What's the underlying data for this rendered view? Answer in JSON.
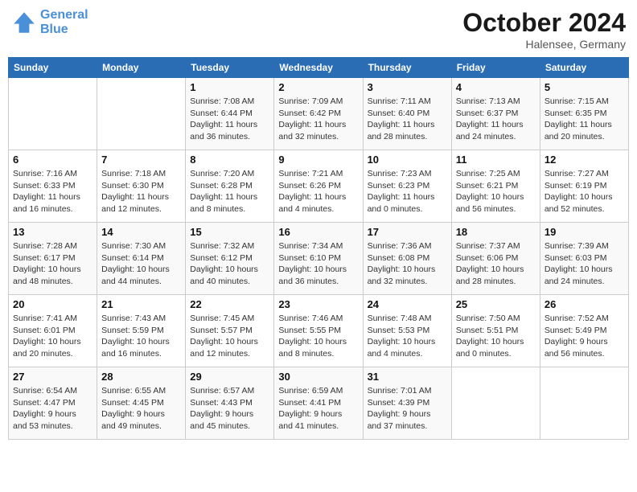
{
  "header": {
    "logo_line1": "General",
    "logo_line2": "Blue",
    "month": "October 2024",
    "location": "Halensee, Germany"
  },
  "days_of_week": [
    "Sunday",
    "Monday",
    "Tuesday",
    "Wednesday",
    "Thursday",
    "Friday",
    "Saturday"
  ],
  "weeks": [
    [
      {
        "day": "",
        "info": ""
      },
      {
        "day": "",
        "info": ""
      },
      {
        "day": "1",
        "info": "Sunrise: 7:08 AM\nSunset: 6:44 PM\nDaylight: 11 hours and 36 minutes."
      },
      {
        "day": "2",
        "info": "Sunrise: 7:09 AM\nSunset: 6:42 PM\nDaylight: 11 hours and 32 minutes."
      },
      {
        "day": "3",
        "info": "Sunrise: 7:11 AM\nSunset: 6:40 PM\nDaylight: 11 hours and 28 minutes."
      },
      {
        "day": "4",
        "info": "Sunrise: 7:13 AM\nSunset: 6:37 PM\nDaylight: 11 hours and 24 minutes."
      },
      {
        "day": "5",
        "info": "Sunrise: 7:15 AM\nSunset: 6:35 PM\nDaylight: 11 hours and 20 minutes."
      }
    ],
    [
      {
        "day": "6",
        "info": "Sunrise: 7:16 AM\nSunset: 6:33 PM\nDaylight: 11 hours and 16 minutes."
      },
      {
        "day": "7",
        "info": "Sunrise: 7:18 AM\nSunset: 6:30 PM\nDaylight: 11 hours and 12 minutes."
      },
      {
        "day": "8",
        "info": "Sunrise: 7:20 AM\nSunset: 6:28 PM\nDaylight: 11 hours and 8 minutes."
      },
      {
        "day": "9",
        "info": "Sunrise: 7:21 AM\nSunset: 6:26 PM\nDaylight: 11 hours and 4 minutes."
      },
      {
        "day": "10",
        "info": "Sunrise: 7:23 AM\nSunset: 6:23 PM\nDaylight: 11 hours and 0 minutes."
      },
      {
        "day": "11",
        "info": "Sunrise: 7:25 AM\nSunset: 6:21 PM\nDaylight: 10 hours and 56 minutes."
      },
      {
        "day": "12",
        "info": "Sunrise: 7:27 AM\nSunset: 6:19 PM\nDaylight: 10 hours and 52 minutes."
      }
    ],
    [
      {
        "day": "13",
        "info": "Sunrise: 7:28 AM\nSunset: 6:17 PM\nDaylight: 10 hours and 48 minutes."
      },
      {
        "day": "14",
        "info": "Sunrise: 7:30 AM\nSunset: 6:14 PM\nDaylight: 10 hours and 44 minutes."
      },
      {
        "day": "15",
        "info": "Sunrise: 7:32 AM\nSunset: 6:12 PM\nDaylight: 10 hours and 40 minutes."
      },
      {
        "day": "16",
        "info": "Sunrise: 7:34 AM\nSunset: 6:10 PM\nDaylight: 10 hours and 36 minutes."
      },
      {
        "day": "17",
        "info": "Sunrise: 7:36 AM\nSunset: 6:08 PM\nDaylight: 10 hours and 32 minutes."
      },
      {
        "day": "18",
        "info": "Sunrise: 7:37 AM\nSunset: 6:06 PM\nDaylight: 10 hours and 28 minutes."
      },
      {
        "day": "19",
        "info": "Sunrise: 7:39 AM\nSunset: 6:03 PM\nDaylight: 10 hours and 24 minutes."
      }
    ],
    [
      {
        "day": "20",
        "info": "Sunrise: 7:41 AM\nSunset: 6:01 PM\nDaylight: 10 hours and 20 minutes."
      },
      {
        "day": "21",
        "info": "Sunrise: 7:43 AM\nSunset: 5:59 PM\nDaylight: 10 hours and 16 minutes."
      },
      {
        "day": "22",
        "info": "Sunrise: 7:45 AM\nSunset: 5:57 PM\nDaylight: 10 hours and 12 minutes."
      },
      {
        "day": "23",
        "info": "Sunrise: 7:46 AM\nSunset: 5:55 PM\nDaylight: 10 hours and 8 minutes."
      },
      {
        "day": "24",
        "info": "Sunrise: 7:48 AM\nSunset: 5:53 PM\nDaylight: 10 hours and 4 minutes."
      },
      {
        "day": "25",
        "info": "Sunrise: 7:50 AM\nSunset: 5:51 PM\nDaylight: 10 hours and 0 minutes."
      },
      {
        "day": "26",
        "info": "Sunrise: 7:52 AM\nSunset: 5:49 PM\nDaylight: 9 hours and 56 minutes."
      }
    ],
    [
      {
        "day": "27",
        "info": "Sunrise: 6:54 AM\nSunset: 4:47 PM\nDaylight: 9 hours and 53 minutes."
      },
      {
        "day": "28",
        "info": "Sunrise: 6:55 AM\nSunset: 4:45 PM\nDaylight: 9 hours and 49 minutes."
      },
      {
        "day": "29",
        "info": "Sunrise: 6:57 AM\nSunset: 4:43 PM\nDaylight: 9 hours and 45 minutes."
      },
      {
        "day": "30",
        "info": "Sunrise: 6:59 AM\nSunset: 4:41 PM\nDaylight: 9 hours and 41 minutes."
      },
      {
        "day": "31",
        "info": "Sunrise: 7:01 AM\nSunset: 4:39 PM\nDaylight: 9 hours and 37 minutes."
      },
      {
        "day": "",
        "info": ""
      },
      {
        "day": "",
        "info": ""
      }
    ]
  ]
}
